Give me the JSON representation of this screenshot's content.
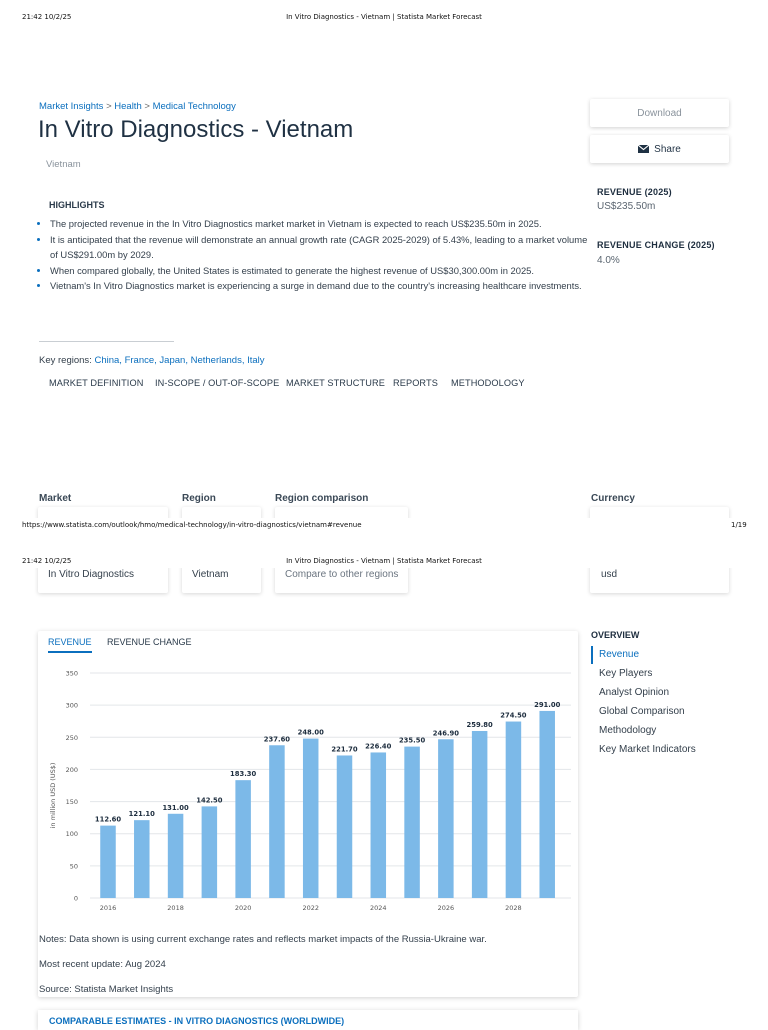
{
  "print_header": {
    "datetime": "21:42 10/2/25",
    "title": "In Vitro Diagnostics - Vietnam | Statista Market Forecast"
  },
  "print_footer": {
    "url": "https://www.statista.com/outlook/hmo/medical-technology/in-vitro-diagnostics/vietnam#revenue",
    "page": "1/19"
  },
  "breadcrumb": {
    "items": [
      "Market Insights",
      "Health",
      "Medical Technology"
    ],
    "separator": ">"
  },
  "page_title": "In Vitro Diagnostics - Vietnam",
  "subtitle": "Vietnam",
  "actions": {
    "download": "Download",
    "share": "Share",
    "share_icon": "envelope-icon"
  },
  "kpis": [
    {
      "label": "REVENUE (2025)",
      "value": "US$235.50m"
    },
    {
      "label": "REVENUE CHANGE (2025)",
      "value": "4.0%"
    }
  ],
  "highlights": {
    "heading": "HIGHLIGHTS",
    "items": [
      "The projected revenue in the In Vitro Diagnostics market market in Vietnam is expected to reach US$235.50m in 2025.",
      "It is anticipated that the revenue will demonstrate an annual growth rate (CAGR 2025-2029) of 5.43%, leading to a market volume of US$291.00m by 2029.",
      "When compared globally, the United States is estimated to generate the highest revenue of US$30,300.00m in 2025.",
      "Vietnam's In Vitro Diagnostics market is experiencing a surge in demand due to the country's increasing healthcare investments."
    ]
  },
  "key_regions": {
    "label": "Key regions:",
    "regions": [
      "China",
      "France",
      "Japan",
      "Netherlands",
      "Italy"
    ],
    "sep": ", "
  },
  "section_tabs": [
    "MARKET DEFINITION",
    "IN-SCOPE / OUT-OF-SCOPE",
    "MARKET STRUCTURE",
    "REPORTS",
    "METHODOLOGY"
  ],
  "selectors": {
    "market": {
      "label": "Market",
      "value": "In Vitro Diagnostics"
    },
    "region": {
      "label": "Region",
      "value": "Vietnam"
    },
    "comparison": {
      "label": "Region comparison",
      "value": "Compare to other regions"
    },
    "currency": {
      "label": "Currency",
      "value": "usd"
    }
  },
  "chart_tabs": [
    "REVENUE",
    "REVENUE CHANGE"
  ],
  "chart_data": {
    "type": "bar",
    "title": "",
    "xlabel": "",
    "ylabel": "in million USD (US$)",
    "categories": [
      "2016",
      "2017",
      "2018",
      "2019",
      "2020",
      "2021",
      "2022",
      "2023",
      "2024",
      "2025",
      "2026",
      "2027",
      "2028",
      "2029"
    ],
    "values": [
      112.6,
      121.1,
      131.0,
      142.5,
      183.3,
      237.6,
      248.0,
      221.7,
      226.4,
      235.5,
      246.9,
      259.8,
      274.5,
      291.0
    ],
    "value_labels": [
      "112.60",
      "121.10",
      "131.00",
      "142.50",
      "183.30",
      "237.60",
      "248.00",
      "221.70",
      "226.40",
      "235.50",
      "246.90",
      "259.80",
      "274.50",
      "291.00"
    ],
    "x_tick_labels": [
      "2016",
      "2018",
      "2020",
      "2022",
      "2024",
      "2026",
      "2028"
    ],
    "y_ticks": [
      0,
      50,
      100,
      150,
      200,
      250,
      300,
      350
    ],
    "ylim": [
      0,
      350
    ],
    "grid": true,
    "bar_color": "#7cb9e8"
  },
  "overview": {
    "heading": "OVERVIEW",
    "items": [
      "Revenue",
      "Key Players",
      "Analyst Opinion",
      "Global Comparison",
      "Methodology",
      "Key Market Indicators"
    ],
    "active_index": 0
  },
  "notes": {
    "note": "Notes: Data shown is using current exchange rates and reflects market impacts of the Russia-Ukraine war.",
    "update": "Most recent update: Aug 2024",
    "source": "Source: Statista Market Insights"
  },
  "next_section_title": "COMPARABLE ESTIMATES - IN VITRO DIAGNOSTICS (WORLDWIDE)",
  "colors": {
    "accent": "#0b6fbe",
    "bar": "#7cb9e8",
    "text": "#333f4b"
  }
}
